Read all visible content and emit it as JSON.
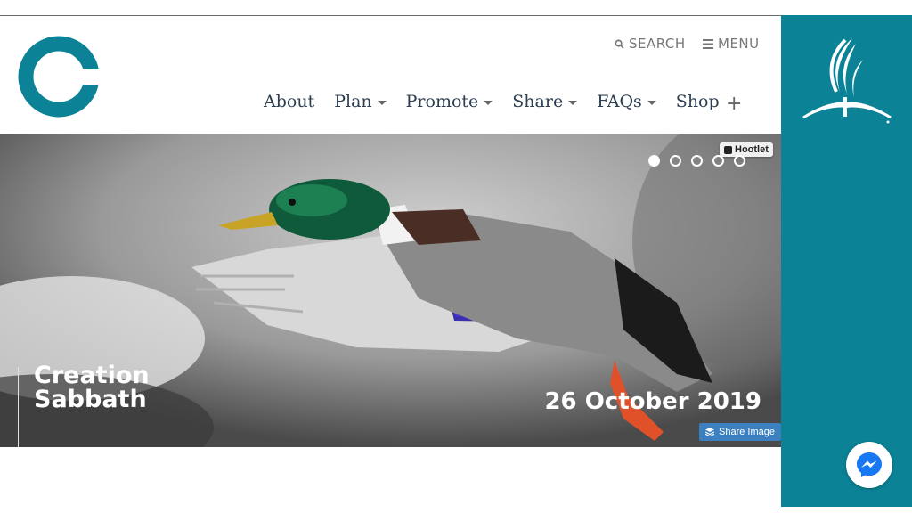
{
  "header": {
    "search_label": "SEARCH",
    "menu_label": "MENU"
  },
  "nav": {
    "items": [
      {
        "label": "About",
        "has_dropdown": false
      },
      {
        "label": "Plan",
        "has_dropdown": true
      },
      {
        "label": "Promote",
        "has_dropdown": true
      },
      {
        "label": "Share",
        "has_dropdown": true
      },
      {
        "label": "FAQs",
        "has_dropdown": true
      },
      {
        "label": "Shop",
        "has_dropdown": false
      }
    ],
    "more_label": "+"
  },
  "hero": {
    "hootlet_label": "Hootlet",
    "slide_count": 5,
    "active_slide": 1,
    "title_line1": "Creation",
    "title_line2": "Sabbath",
    "date": "26 October 2019",
    "share_label": "Share Image"
  },
  "colors": {
    "brand_teal": "#0b8296",
    "nav_text": "#2c3e50",
    "share_button": "#3d80c0"
  },
  "icons": {
    "logo": "creation-logo-icon",
    "sda": "sda-church-logo-icon",
    "messenger": "messenger-icon"
  }
}
